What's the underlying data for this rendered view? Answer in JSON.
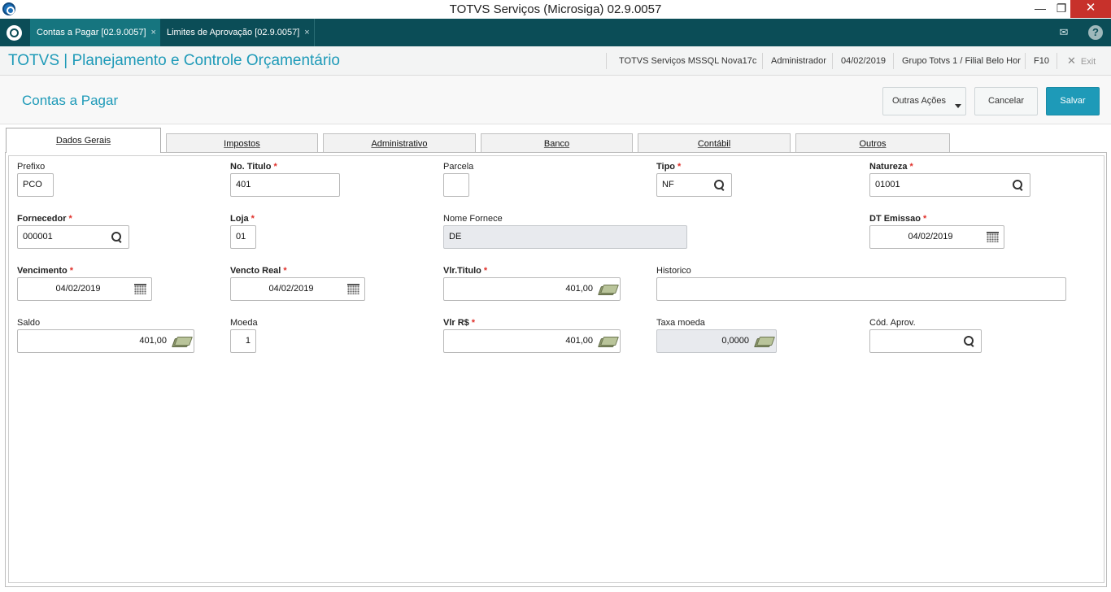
{
  "window": {
    "title": "TOTVS Serviços (Microsiga) 02.9.0057",
    "minimize_glyph": "—",
    "maximize_glyph": "❐",
    "close_glyph": "✕"
  },
  "program_tabs": [
    {
      "label": "Contas a Pagar [02.9.0057]",
      "close": "×"
    },
    {
      "label": "Limites de Aprovação [02.9.0057]",
      "close": "×"
    }
  ],
  "top_icons": {
    "mail": "✉",
    "help": "?"
  },
  "module": {
    "title": "TOTVS | Planejamento e Controle Orçamentário",
    "environment": "TOTVS Serviços MSSQL Nova17c",
    "user": "Administrador",
    "date": "04/02/2019",
    "branch": "Grupo Totvs 1 / Filial Belo Hor",
    "shortcut": "F10",
    "exit_label": "Exit",
    "exit_glyph": "✕"
  },
  "page": {
    "title": "Contas a Pagar",
    "buttons": {
      "other_actions": "Outras Ações",
      "cancel": "Cancelar",
      "save": "Salvar"
    }
  },
  "form_tabs": [
    "Dados Gerais",
    "Impostos",
    "Administrativo",
    "Banco",
    "Contábil",
    "Outros"
  ],
  "fields": {
    "prefixo": {
      "label": "Prefixo",
      "value": "PCO"
    },
    "no_titulo": {
      "label": "No. Titulo",
      "value": "401"
    },
    "parcela": {
      "label": "Parcela",
      "value": ""
    },
    "tipo": {
      "label": "Tipo",
      "value": "NF"
    },
    "natureza": {
      "label": "Natureza",
      "value": "01001"
    },
    "fornecedor": {
      "label": "Fornecedor",
      "value": "000001"
    },
    "loja": {
      "label": "Loja",
      "value": "01"
    },
    "nome_fornece": {
      "label": "Nome Fornece",
      "value": "DE"
    },
    "dt_emissao": {
      "label": "DT Emissao",
      "value": "04/02/2019"
    },
    "vencimento": {
      "label": "Vencimento",
      "value": "04/02/2019"
    },
    "vencto_real": {
      "label": "Vencto Real",
      "value": "04/02/2019"
    },
    "vlr_titulo": {
      "label": "Vlr.Titulo",
      "value": "401,00"
    },
    "historico": {
      "label": "Historico",
      "value": ""
    },
    "saldo": {
      "label": "Saldo",
      "value": "401,00"
    },
    "moeda": {
      "label": "Moeda",
      "value": "1"
    },
    "vlr_rs": {
      "label": "Vlr R$",
      "value": "401,00"
    },
    "taxa_moeda": {
      "label": "Taxa moeda",
      "value": "0,0000"
    },
    "cod_aprov": {
      "label": "Cód. Aprov.",
      "value": ""
    }
  },
  "required_mark": "*",
  "colors": {
    "accent": "#1e9ab8",
    "tabbar": "#0b4d57",
    "active_tab": "#16757f",
    "required": "#e0302a",
    "close_button": "#c7312b"
  }
}
